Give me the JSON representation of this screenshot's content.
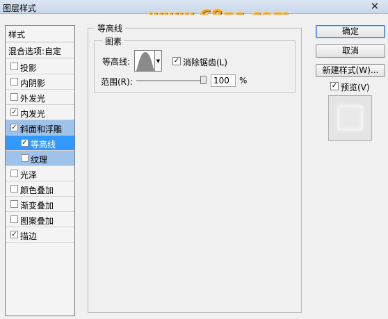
{
  "window": {
    "title": "图层样式",
    "close_glyph": "✕"
  },
  "watermark": "www.68ps.com",
  "style_list": {
    "header": "样式",
    "blend_options": "混合选项:自定",
    "items": [
      {
        "label": "投影",
        "checked": false
      },
      {
        "label": "内阴影",
        "checked": false
      },
      {
        "label": "外发光",
        "checked": false
      },
      {
        "label": "内发光",
        "checked": true
      },
      {
        "label": "斜面和浮雕",
        "checked": true,
        "selected": "light"
      },
      {
        "label": "等高线",
        "checked": true,
        "selected": "dark",
        "sub": true
      },
      {
        "label": "纹理",
        "checked": false,
        "selected": "light",
        "sub": true
      },
      {
        "label": "光泽",
        "checked": false
      },
      {
        "label": "颜色叠加",
        "checked": false
      },
      {
        "label": "渐变叠加",
        "checked": false
      },
      {
        "label": "图案叠加",
        "checked": false
      },
      {
        "label": "描边",
        "checked": true
      }
    ]
  },
  "panel": {
    "group_title": "等高线",
    "sub_group_title": "图素",
    "contour_label": "等高线:",
    "anti_alias_label": "消除锯齿(L)",
    "anti_alias_checked": true,
    "range_label": "范围(R):",
    "range_value": "100",
    "range_unit": "%",
    "range_level": 1.0
  },
  "buttons": {
    "ok": "确定",
    "cancel": "取消",
    "new_style": "新建样式(W)..."
  },
  "preview": {
    "label": "预览(V)",
    "checked": true
  },
  "colors": {
    "selected_dark": "#3399ff",
    "selected_light": "#9ec2ea",
    "watermark": "#f2a323"
  }
}
